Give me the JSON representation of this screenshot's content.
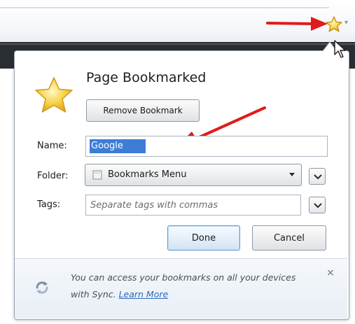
{
  "panel": {
    "title": "Page Bookmarked",
    "remove_label": "Remove Bookmark"
  },
  "form": {
    "name_label": "Name:",
    "name_value": "Google",
    "folder_label": "Folder:",
    "folder_value": "Bookmarks Menu",
    "tags_label": "Tags:",
    "tags_placeholder": "Separate tags with commas"
  },
  "actions": {
    "done_label": "Done",
    "cancel_label": "Cancel"
  },
  "sync": {
    "message": "You can access your bookmarks on all your devices with Sync.",
    "link_label": "Learn More",
    "close_glyph": "×"
  },
  "icons": {
    "toolbar_star": "bookmark-star-icon",
    "big_star": "star-icon",
    "folder": "folder-icon",
    "sync": "sync-icon",
    "close": "close-icon",
    "chevron": "chevron-down-icon",
    "cursor": "mouse-pointer-icon"
  },
  "colors": {
    "star_fill": "#f6d44a",
    "highlight": "#3d7dd6",
    "link": "#2f68bd",
    "arrow": "#e11b1b",
    "focus_border": "#5d9ad3"
  }
}
